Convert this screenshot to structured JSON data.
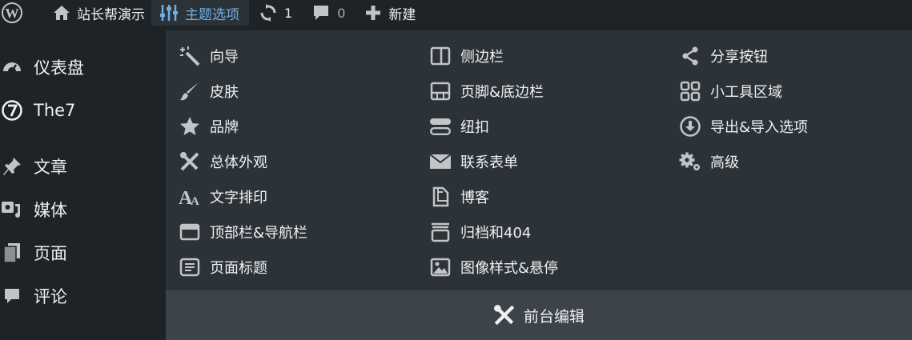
{
  "adminbar": {
    "site_name": "站长帮演示",
    "theme_options": "主题选项",
    "updates_count": "1",
    "comments_count": "0",
    "new_label": "新建"
  },
  "sidebar": {
    "items": [
      {
        "label": "仪表盘",
        "icon": "dashboard-icon"
      },
      {
        "label": "The7",
        "icon": "the7-icon"
      },
      {
        "label": "文章",
        "icon": "pin-icon"
      },
      {
        "label": "媒体",
        "icon": "media-icon"
      },
      {
        "label": "页面",
        "icon": "pages-icon"
      },
      {
        "label": "评论",
        "icon": "comment-icon"
      }
    ]
  },
  "submenu": {
    "col1": [
      {
        "label": "向导",
        "icon": "wizard-icon"
      },
      {
        "label": "皮肤",
        "icon": "brush-icon"
      },
      {
        "label": "品牌",
        "icon": "star-icon"
      },
      {
        "label": "总体外观",
        "icon": "tools-icon"
      },
      {
        "label": "文字排印",
        "icon": "typography-icon"
      },
      {
        "label": "顶部栏&导航栏",
        "icon": "window-icon"
      },
      {
        "label": "页面标题",
        "icon": "text-box-icon"
      }
    ],
    "col2": [
      {
        "label": "侧边栏",
        "icon": "sidebar-icon"
      },
      {
        "label": "页脚&底边栏",
        "icon": "footer-icon"
      },
      {
        "label": "纽扣",
        "icon": "buttons-icon"
      },
      {
        "label": "联系表单",
        "icon": "envelope-icon"
      },
      {
        "label": "博客",
        "icon": "copy-icon"
      },
      {
        "label": "归档和404",
        "icon": "archive-icon"
      },
      {
        "label": "图像样式&悬停",
        "icon": "image-icon"
      }
    ],
    "col3": [
      {
        "label": "分享按钮",
        "icon": "share-icon"
      },
      {
        "label": "小工具区域",
        "icon": "widgets-icon"
      },
      {
        "label": "导出&导入选项",
        "icon": "download-icon"
      },
      {
        "label": "高级",
        "icon": "gears-icon"
      }
    ],
    "footer_label": "前台编辑"
  },
  "colors": {
    "bar_bg": "#1d2327",
    "submenu_bg": "#2c3338",
    "footer_bg": "#3c434a",
    "active_text": "#72aee6",
    "text": "#f0f0f1"
  }
}
